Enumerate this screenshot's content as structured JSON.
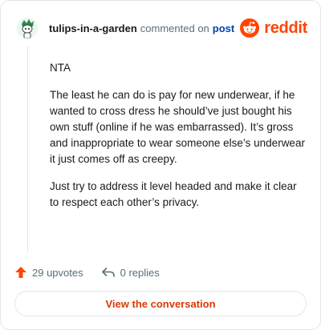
{
  "header": {
    "username": "tulips-in-a-garden",
    "action_text": "commented on",
    "post_link": "post",
    "brand": "reddit"
  },
  "comment": {
    "paragraphs": [
      "NTA",
      "The least he can do is pay for new underwear, if he wanted to cross dress he should’ve just bought his own stuff (online if he was embarrassed). It’s gross and inappropriate to wear someone else’s underwear it just comes off as creepy.",
      "Just try to address it level headed and make it clear to respect each other’s privacy."
    ]
  },
  "footer": {
    "upvotes": "29 upvotes",
    "replies": "0 replies",
    "cta": "View the conversation"
  },
  "icons": {
    "avatar": "snoo-avatar-icon",
    "brand": "reddit-logo-icon",
    "upvote": "upvote-arrow-icon",
    "reply": "reply-arrow-icon"
  },
  "colors": {
    "brand": "#ff4500",
    "link": "#0045ac",
    "cta": "#d93900",
    "muted": "#576f76"
  }
}
